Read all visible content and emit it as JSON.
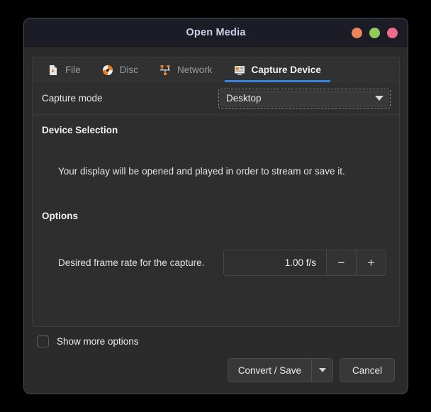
{
  "window": {
    "title": "Open Media",
    "controls": [
      {
        "name": "minimize",
        "color": "#e8865a"
      },
      {
        "name": "maximize",
        "color": "#8fcc5a"
      },
      {
        "name": "close",
        "color": "#ec6a8a"
      }
    ]
  },
  "tabs": [
    {
      "label": "File",
      "icon": "file-video-icon",
      "active": false
    },
    {
      "label": "Disc",
      "icon": "disc-icon",
      "active": false
    },
    {
      "label": "Network",
      "icon": "network-icon",
      "active": false
    },
    {
      "label": "Capture Device",
      "icon": "capture-device-icon",
      "active": true
    }
  ],
  "capture_mode": {
    "label": "Capture mode",
    "value": "Desktop",
    "caret_icon": "chevron-down-icon"
  },
  "device_selection": {
    "title": "Device Selection",
    "description": "Your display will be opened and played in order to stream or save it."
  },
  "options": {
    "title": "Options",
    "frame_rate": {
      "label": "Desired frame rate for the capture.",
      "value": "1.00 f/s",
      "decrement_label": "−",
      "increment_label": "+"
    }
  },
  "footer": {
    "show_more_label": "Show more options",
    "show_more_checked": false,
    "convert_save_label": "Convert / Save",
    "convert_save_arrow_icon": "chevron-down-icon",
    "cancel_label": "Cancel"
  },
  "colors": {
    "accent": "#3584e4",
    "titlebar_bg": "#1c1c26",
    "window_bg": "#2b2b2b",
    "panel_bg": "#2e2e2e"
  }
}
